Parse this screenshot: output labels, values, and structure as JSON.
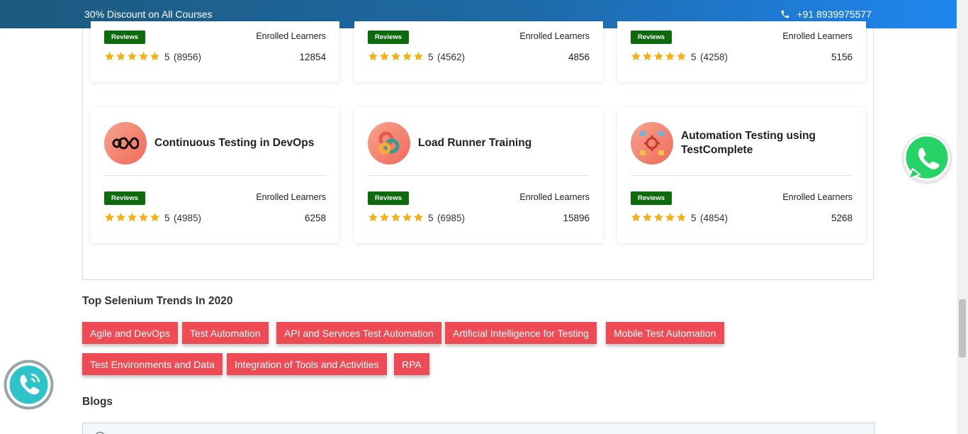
{
  "topbar": {
    "discount": "30% Discount on All Courses",
    "phone": "+91 8939975577"
  },
  "common": {
    "reviews_badge": "Reviews",
    "enrolled_label": "Enrolled Learners"
  },
  "courses_top": [
    {
      "rating": "5",
      "count": "(8956)",
      "enrolled": "12854"
    },
    {
      "rating": "5",
      "count": "(4562)",
      "enrolled": "4856"
    },
    {
      "rating": "5",
      "count": "(4258)",
      "enrolled": "5156"
    }
  ],
  "courses": [
    {
      "title": "Continuous Testing in DevOps",
      "rating": "5",
      "count": "(4985)",
      "enrolled": "6258",
      "icon": "devops-infinity-icon"
    },
    {
      "title": "Load Runner Training",
      "rating": "5",
      "count": "(6985)",
      "enrolled": "15896",
      "icon": "loadrunner-loop-icon"
    },
    {
      "title": "Automation Testing using TestComplete",
      "rating": "5",
      "count": "(4854)",
      "enrolled": "5268",
      "icon": "testcomplete-gear-icon"
    }
  ],
  "trends": {
    "title": "Top Selenium Trends In 2020",
    "tags": [
      "Agile and DevOps",
      "Test Automation",
      "API and Services Test Automation",
      "Artificial Intelligence for Testing",
      "Mobile Test Automation",
      "Test Environments and Data",
      "Integration of Tools and Activities",
      "RPA"
    ]
  },
  "blogs": {
    "title": "Blogs"
  },
  "colors": {
    "tag": "#ee4b54",
    "badge": "#0d6b0d",
    "star": "#f5b016",
    "whatsapp": "#25d366"
  }
}
